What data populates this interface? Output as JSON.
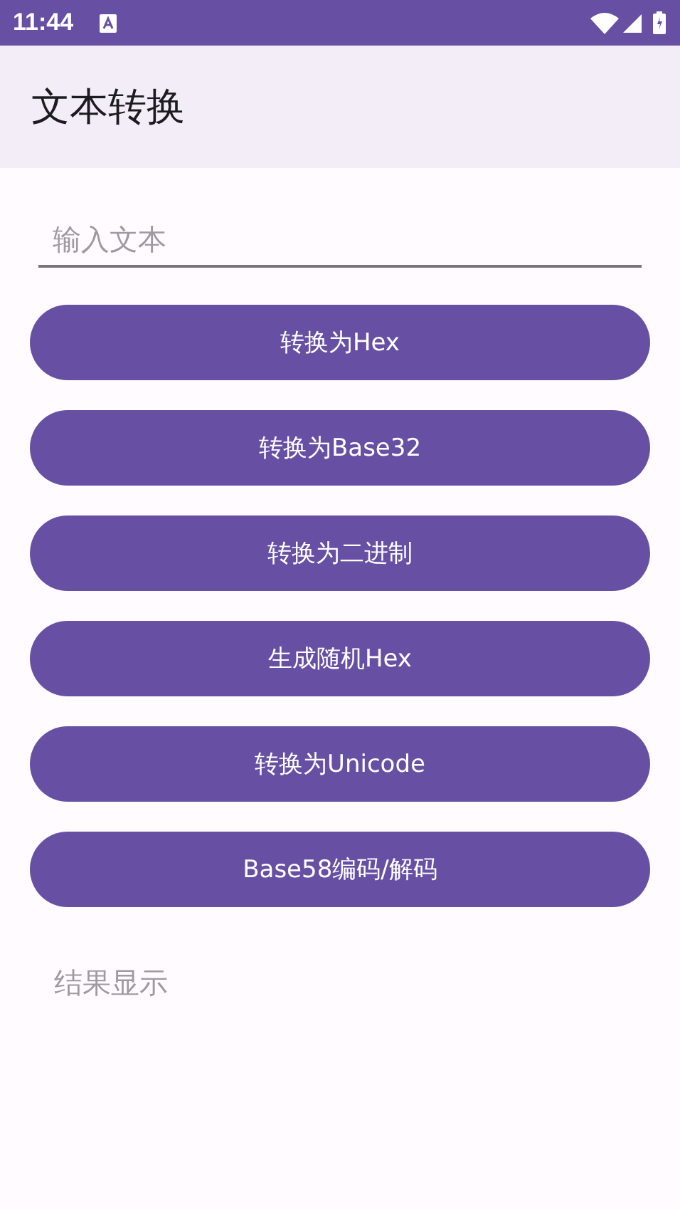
{
  "status_bar": {
    "time": "11:44"
  },
  "app_bar": {
    "title": "文本转换"
  },
  "input": {
    "placeholder": "输入文本"
  },
  "buttons": [
    {
      "label": "转换为Hex"
    },
    {
      "label": "转换为Base32"
    },
    {
      "label": "转换为二进制"
    },
    {
      "label": "生成随机Hex"
    },
    {
      "label": "转换为Unicode"
    },
    {
      "label": "Base58编码/解码"
    }
  ],
  "result": {
    "placeholder": "结果显示"
  }
}
